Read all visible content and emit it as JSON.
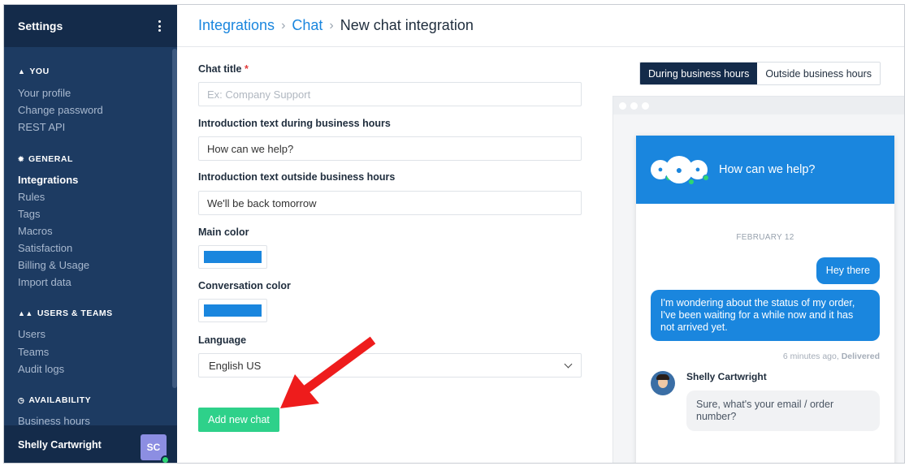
{
  "sidebar": {
    "title": "Settings",
    "sections": {
      "you": {
        "label": "YOU",
        "icon": "person-icon",
        "items": [
          "Your profile",
          "Change password",
          "REST API"
        ]
      },
      "general": {
        "label": "GENERAL",
        "icon": "gear-icon",
        "items": [
          "Integrations",
          "Rules",
          "Tags",
          "Macros",
          "Satisfaction",
          "Billing & Usage",
          "Import data"
        ]
      },
      "users": {
        "label": "USERS & TEAMS",
        "icon": "people-icon",
        "items": [
          "Users",
          "Teams",
          "Audit logs"
        ]
      },
      "availability": {
        "label": "AVAILABILITY",
        "icon": "clock-icon",
        "items": [
          "Business hours"
        ]
      }
    },
    "active_item": "Integrations",
    "user": {
      "name": "Shelly Cartwright",
      "initials": "SC",
      "status_color": "#2ed573"
    }
  },
  "breadcrumb": {
    "link1": "Integrations",
    "link2": "Chat",
    "current": "New chat integration",
    "separator": "›"
  },
  "form": {
    "chat_title": {
      "label": "Chat title",
      "required_mark": "*",
      "placeholder": "Ex: Company Support",
      "value": ""
    },
    "intro_during": {
      "label": "Introduction text during business hours",
      "value": "How can we help?"
    },
    "intro_outside": {
      "label": "Introduction text outside business hours",
      "value": "We'll be back tomorrow"
    },
    "main_color": {
      "label": "Main color",
      "value": "#1a86de"
    },
    "conversation_color": {
      "label": "Conversation color",
      "value": "#1a86de"
    },
    "language": {
      "label": "Language",
      "selected": "English US"
    },
    "submit_label": "Add new chat"
  },
  "preview": {
    "toggle": {
      "during": "During business hours",
      "outside": "Outside business hours",
      "active": "during"
    },
    "header_text": "How can we help?",
    "date_label": "FEBRUARY 12",
    "messages": {
      "user1": "Hey there",
      "user2": "I'm wondering about the status of my order, I've been waiting for a while now and it has not arrived yet.",
      "meta_time": "6 minutes ago,",
      "meta_status": "Delivered",
      "agent_name": "Shelly Cartwright",
      "agent_reply": "Sure, what's your email / order number?"
    }
  },
  "colors": {
    "accent": "#1a86de",
    "sidebar_bg": "#1d3b62",
    "sidebar_dark": "#142b4a",
    "button_green": "#2ed18a",
    "annotation_arrow": "#ee1c1c"
  }
}
